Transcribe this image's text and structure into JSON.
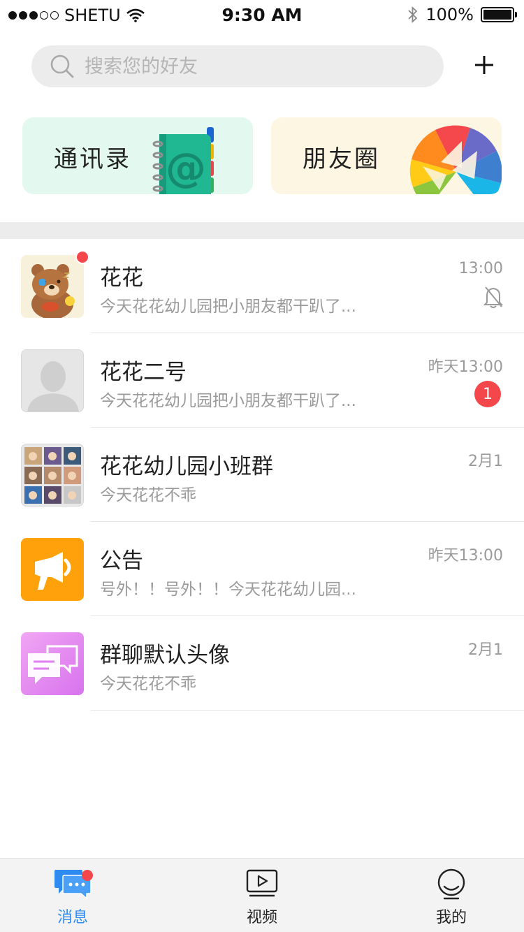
{
  "status_bar": {
    "carrier": "SHETU",
    "time": "9:30 AM",
    "battery": "100%",
    "battery_level": 1.0,
    "signal_bars": 3,
    "signal_total": 5
  },
  "search": {
    "placeholder": "搜索您的好友"
  },
  "shortcuts": {
    "contacts_label": "通讯录",
    "moments_label": "朋友圈"
  },
  "chats": [
    {
      "name": "花花",
      "preview": "今天花花幼儿园把小朋友都干趴了...",
      "time": "13:00",
      "muted": true,
      "unread_dot": true
    },
    {
      "name": "花花二号",
      "preview": "今天花花幼儿园把小朋友都干趴了...",
      "time": "昨天13:00",
      "unread_count": "1"
    },
    {
      "name": "花花幼儿园小班群",
      "preview": "今天花花不乖",
      "time": "2月1"
    },
    {
      "name": "公告",
      "preview": "号外！！号外！！今天花花幼儿园...",
      "time": "昨天13:00"
    },
    {
      "name": "群聊默认头像",
      "preview": "今天花花不乖",
      "time": "2月1"
    }
  ],
  "tabs": [
    {
      "label": "消息",
      "active": true,
      "has_dot": true
    },
    {
      "label": "视频",
      "active": false
    },
    {
      "label": "我的",
      "active": false
    }
  ],
  "colors": {
    "accent": "#2f8bf0",
    "badge": "#f4474b",
    "contacts_card": "#e3f8ee",
    "moments_card": "#fdf6e2",
    "announcement": "#ffa10a",
    "group_chat": "#e784f0"
  }
}
